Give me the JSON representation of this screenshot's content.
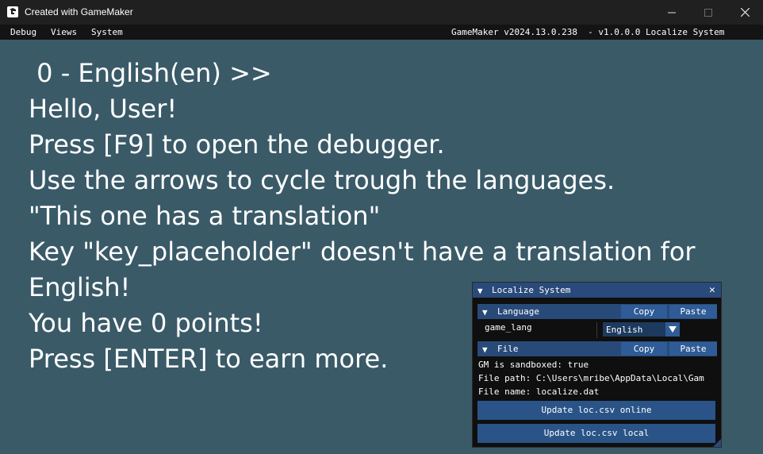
{
  "window": {
    "title": "Created with GameMaker",
    "icon": "gamemaker-logo-icon",
    "controls": [
      "minimize-icon",
      "maximize-icon",
      "close-icon"
    ]
  },
  "debug_menu": {
    "items": [
      "Debug",
      "Views",
      "System"
    ],
    "version": "GameMaker v2024.13.0.238  - v1.0.0.0 Localize System"
  },
  "main_text": [
    " 0 - English(en) >>",
    "Hello, User!",
    "Press [F9] to open the debugger.",
    "Use the arrows to cycle trough the languages.",
    "\"This one has a translation\"",
    "Key \"key_placeholder\" doesn't have a translation for",
    "English!",
    "You have 0 points!",
    "Press [ENTER] to earn more."
  ],
  "panel": {
    "title": "Localize System",
    "collapse_glyph": "▼",
    "close_glyph": "✕",
    "language_section": {
      "label": "Language",
      "copy": "Copy",
      "paste": "Paste",
      "field_label": "game_lang",
      "selected": "English"
    },
    "file_section": {
      "label": "File",
      "copy": "Copy",
      "paste": "Paste",
      "sandboxed": "GM is sandboxed: true",
      "file_path": "File path: C:\\Users\\mribe\\AppData\\Local\\Gam",
      "file_name": "File name: localize.dat"
    },
    "buttons": {
      "update_online": "Update loc.csv online",
      "update_local": "Update loc.csv local"
    }
  },
  "colors": {
    "background": "#3a5a68",
    "panel_header": "#294a7a",
    "button": "#2f5c96"
  }
}
